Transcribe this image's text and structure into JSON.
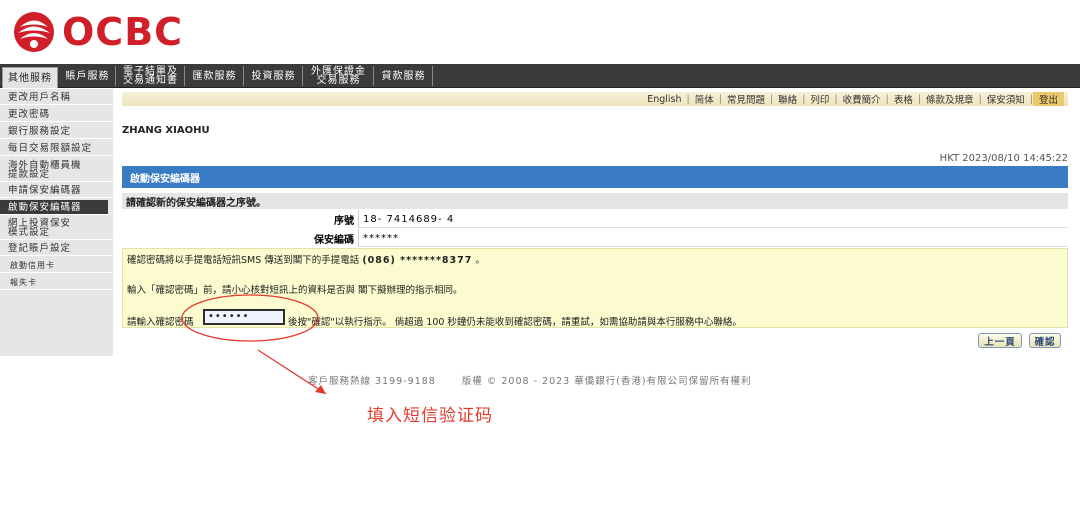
{
  "brand": {
    "name": "OCBC",
    "color": "#d11f2a"
  },
  "top_nav": {
    "tabs": [
      {
        "label": "其他服務"
      },
      {
        "label": "賬戶服務"
      },
      {
        "label": "電子結單及\n交易通知書"
      },
      {
        "label": "匯款服務"
      },
      {
        "label": "投資服務"
      },
      {
        "label": "外匯保證金\n交易服務"
      },
      {
        "label": "貸款服務"
      }
    ]
  },
  "sidebar": {
    "items": [
      {
        "label": "更改用戶名稱"
      },
      {
        "label": "更改密碼"
      },
      {
        "label": "銀行服務設定"
      },
      {
        "label": "每日交易限額設定"
      },
      {
        "label": "海外自動櫃員機\n提款設定"
      },
      {
        "label": "申請保安編碼器"
      },
      {
        "label": "啟動保安編碼器"
      },
      {
        "label": "網上投資保安\n模式設定"
      },
      {
        "label": "登記賬戶設定"
      },
      {
        "label": "啟動信用卡"
      },
      {
        "label": "報失卡"
      }
    ]
  },
  "utility_links": [
    "English",
    "简体",
    "常見問題",
    "聯絡",
    "列印",
    "收費簡介",
    "表格",
    "條款及規章",
    "保安須知",
    "登出"
  ],
  "user": {
    "name": "ZHANG XIAOHU"
  },
  "timestamp": "HKT 2023/08/10 14:45:22",
  "card": {
    "title": "啟動保安編碼器",
    "confirm_heading": "請確認新的保安編碼器之序號。",
    "fields": [
      {
        "label": "序號",
        "value": "18- 7414689- 4"
      },
      {
        "label": "保安編碼",
        "value": "******"
      }
    ],
    "notice": {
      "line1_prefix": "確認密碼將以手提電話短訊SMS 傳送到閣下的手提電話",
      "phone": "(086) *******8377",
      "line1_suffix": "。",
      "line2": "輸入「確認密碼」前，請小心核對短訊上的資料是否與 閣下擬辦理的指示相同。",
      "line3_prefix": "請輸入確認密碼",
      "line3_suffix": "後按\"確認\"以執行指示。 倘超過 100 秒鐘仍未能收到確認密碼，請重試，如需協助請與本行服務中心聯絡。",
      "password_value": "••••••"
    }
  },
  "buttons": {
    "back": "上一頁",
    "confirm": "確認"
  },
  "footer": {
    "hotline": "客戶服務熱線 3199-9188",
    "copyright": "版權 © 2008 - 2023 華僑銀行(香港)有限公司保留所有權利"
  },
  "annotation": {
    "text": "填入短信验证码",
    "color": "#e53a2e"
  }
}
